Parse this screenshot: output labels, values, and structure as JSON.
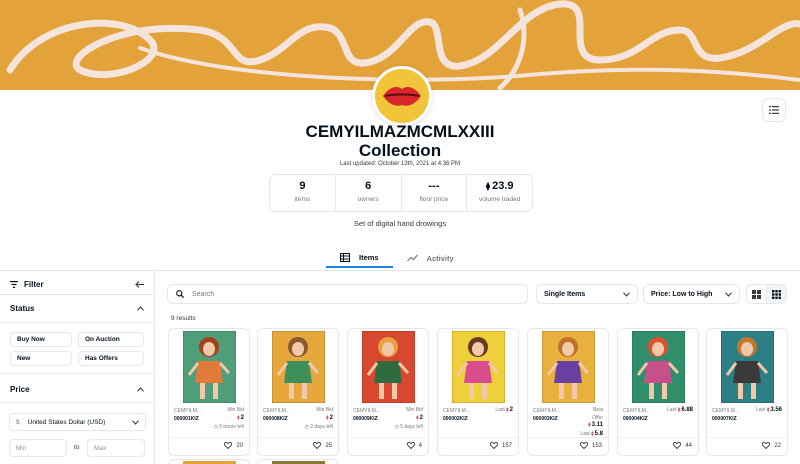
{
  "collection": {
    "title_line1": "CEMYILMAZMCMLXXIII",
    "title_line2": "Collection",
    "last_updated": "Last updated: October 13th, 2021 at 4:36 PM",
    "description": "Set of digital hand drowings"
  },
  "stats": [
    {
      "value": "9",
      "label": "items"
    },
    {
      "value": "6",
      "label": "owners"
    },
    {
      "value": "---",
      "label": "floor price"
    },
    {
      "value": "23.9",
      "label": "volume traded",
      "eth": "⧫"
    }
  ],
  "tabs": [
    {
      "label": "Items",
      "icon": "grid-table-icon",
      "active": true
    },
    {
      "label": "Activity",
      "icon": "chart-line-icon",
      "active": false
    }
  ],
  "sidebar": {
    "filter_label": "Filter",
    "status_label": "Status",
    "status_options": [
      "Buy Now",
      "On Auction",
      "New",
      "Has Offers"
    ],
    "price_label": "Price",
    "currency_symbol": "$",
    "currency": "United States Dollar (USD)",
    "min_placeholder": "Min",
    "to_label": "to",
    "max_placeholder": "Max"
  },
  "toolbar": {
    "search_placeholder": "Search",
    "items_select": "Single Items",
    "sort_select": "Price: Low to High"
  },
  "results_text": "9 results",
  "colors": {
    "banner": "#e3a23a",
    "accent": "#2081e2",
    "eth_red": "#e05252"
  },
  "cards": [
    {
      "name": "CEMYILM...",
      "id": "000001KIZ",
      "lines": [
        {
          "label": "Min Bid"
        },
        {
          "price": "2",
          "eth": true
        },
        {
          "label": "◷ 5 hours left"
        }
      ],
      "favs": "20",
      "art_bg": "#4f9e7a",
      "figure": "#e07a3a",
      "hair": "#a0421c"
    },
    {
      "name": "CEMYILM...",
      "id": "000008KIZ",
      "lines": [
        {
          "label": "Min Bid"
        },
        {
          "price": "2",
          "eth": true
        },
        {
          "label": "◷ 2 days left"
        }
      ],
      "favs": "25",
      "art_bg": "#e6a73c",
      "figure": "#3f8f5a",
      "hair": "#8a5a2a"
    },
    {
      "name": "CEMYILM...",
      "id": "000009KIZ",
      "lines": [
        {
          "label": "Min Bid"
        },
        {
          "price": "2",
          "eth": true
        },
        {
          "label": "◷ 5 days left"
        }
      ],
      "favs": "4",
      "art_bg": "#d8482e",
      "figure": "#2f6b3f",
      "hair": "#e6a040"
    },
    {
      "name": "CEMYILM...",
      "id": "000002KIZ",
      "lines": [
        {
          "label": "Last",
          "price": "2",
          "eth": true
        }
      ],
      "favs": "157",
      "art_bg": "#efcf3a",
      "figure": "#d84e8c",
      "hair": "#6a3a20"
    },
    {
      "name": "CEMYILM...",
      "id": "000003KIZ",
      "lines": [
        {
          "label": "Best"
        },
        {
          "label": "Offer"
        },
        {
          "price": "3.11",
          "eth": true
        },
        {
          "label": "Last",
          "price": "5.8",
          "eth": true
        }
      ],
      "favs": "153",
      "art_bg": "#e8b03c",
      "figure": "#6b3fa0",
      "hair": "#c0702a"
    },
    {
      "name": "CEMYILM...",
      "id": "000004KIZ",
      "lines": [
        {
          "label": "Last",
          "price": "6.88",
          "eth": true
        }
      ],
      "favs": "44",
      "art_bg": "#2f8f6a",
      "figure": "#c8508a",
      "hair": "#e05030"
    },
    {
      "name": "CEMYILM...",
      "id": "000007KIZ",
      "lines": [
        {
          "label": "Last",
          "price": "3.56",
          "eth": true
        }
      ],
      "favs": "22",
      "art_bg": "#2d7f86",
      "figure": "#3a3a3a",
      "hair": "#c07830"
    }
  ],
  "stubs": [
    {
      "color": "#e3a23a"
    },
    {
      "color": "#8a7a3a"
    }
  ]
}
